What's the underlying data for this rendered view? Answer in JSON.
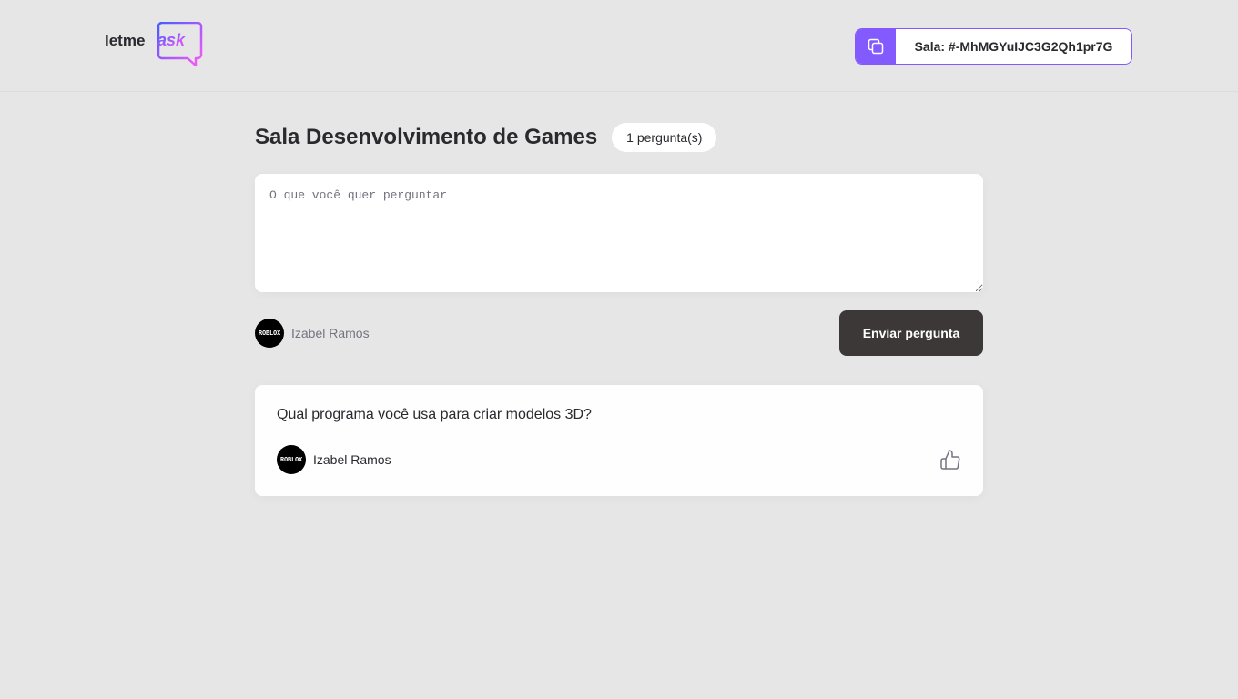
{
  "header": {
    "logo": {
      "brand_part1": "letme",
      "brand_part2": "ask"
    },
    "room_code": {
      "icon": "copy-icon",
      "label": "Sala: #-MhMGYuIJC3G2Qh1pr7G"
    }
  },
  "room": {
    "title": "Sala Desenvolvimento de Games",
    "question_count_label": "1 pergunta(s)"
  },
  "form": {
    "placeholder": "O que você quer perguntar",
    "value": "",
    "user": {
      "name": "Izabel Ramos",
      "avatar_text": "ROBLOX"
    },
    "submit_label": "Enviar pergunta"
  },
  "questions": [
    {
      "content": "Qual programa você usa para criar modelos 3D?",
      "author": {
        "name": "Izabel Ramos",
        "avatar_text": "ROBLOX"
      },
      "like_icon": "thumbs-up-icon",
      "like_count": ""
    }
  ],
  "colors": {
    "accent": "#835afd",
    "page_background": "#e6e6e6",
    "card_background": "#fefefe",
    "button_dark": "#3d3838",
    "text_primary": "#29292e",
    "text_muted": "#737380"
  }
}
